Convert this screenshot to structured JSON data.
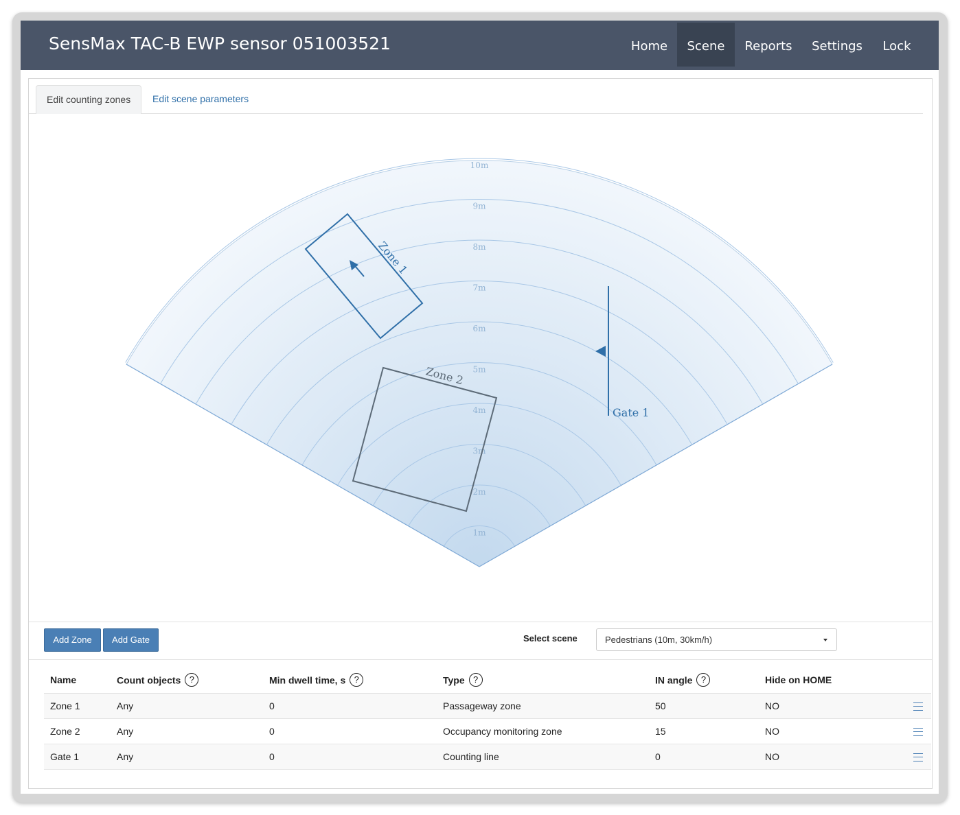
{
  "navbar": {
    "title": "SensMax TAC-B EWP sensor 051003521",
    "items": [
      {
        "label": "Home"
      },
      {
        "label": "Scene",
        "active": true
      },
      {
        "label": "Reports"
      },
      {
        "label": "Settings"
      },
      {
        "label": "Lock"
      }
    ]
  },
  "tabs": [
    {
      "label": "Edit counting zones",
      "active": true
    },
    {
      "label": "Edit scene parameters",
      "active": false
    }
  ],
  "scene": {
    "range_labels": [
      "1m",
      "2m",
      "3m",
      "4m",
      "5m",
      "6m",
      "7m",
      "8m",
      "9m",
      "10m"
    ],
    "zones": [
      {
        "label": "Zone 1",
        "color": "#2f6fa8"
      },
      {
        "label": "Zone 2",
        "color": "#5d6b78"
      }
    ],
    "gates": [
      {
        "label": "Gate 1",
        "color": "#2f6fa8"
      }
    ],
    "colors": {
      "sector_fill": "#cfe0f1",
      "ring_stroke": "#a9c7e6"
    }
  },
  "toolbar": {
    "add_zone_label": "Add Zone",
    "add_gate_label": "Add Gate",
    "select_scene_label": "Select scene",
    "select_scene_value": "Pedestrians (10m, 30km/h)"
  },
  "table": {
    "columns": [
      "Name",
      "Count objects",
      "Min dwell time, s",
      "Type",
      "IN angle",
      "Hide on HOME"
    ],
    "help_icon": "?",
    "rows": [
      {
        "name": "Zone 1",
        "count": "Any",
        "dwell": "0",
        "type": "Passageway zone",
        "angle": "50",
        "hide": "NO"
      },
      {
        "name": "Zone 2",
        "count": "Any",
        "dwell": "0",
        "type": "Occupancy monitoring zone",
        "angle": "15",
        "hide": "NO"
      },
      {
        "name": "Gate 1",
        "count": "Any",
        "dwell": "0",
        "type": "Counting line",
        "angle": "0",
        "hide": "NO"
      }
    ]
  }
}
